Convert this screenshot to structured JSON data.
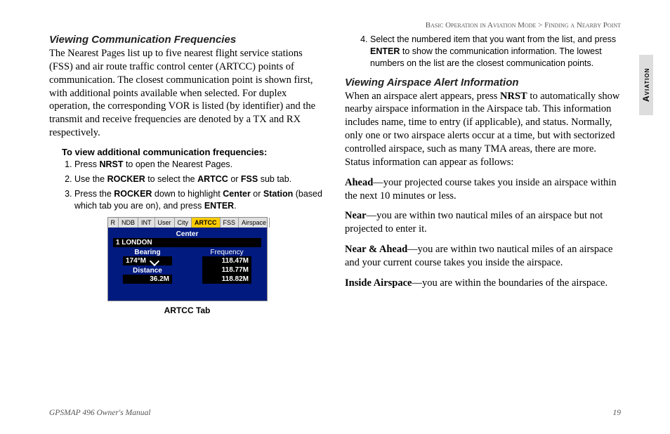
{
  "breadcrumb": {
    "a": "Basic Operation in Aviation Mode",
    "b": "Finding a Nearby Point",
    "sep": " > "
  },
  "sidetab": "Aviation",
  "left": {
    "heading": "Viewing Communication Frequencies",
    "para": "The Nearest Pages list up to five nearest flight service stations (FSS) and air route traffic control center (ARTCC) points of communication. The closest communication point is shown first, with additional points available when selected. For duplex operation, the corresponding VOR is listed (by identifier) and the transmit and receive frequencies are denoted by a TX and RX respectively.",
    "howto_title": "To view additional communication frequencies:",
    "steps": {
      "s1a": "Press ",
      "s1b": "NRST",
      "s1c": " to open the Nearest Pages.",
      "s2a": "Use the ",
      "s2b": "ROCKER",
      "s2c": " to select the ",
      "s2d": "ARTCC",
      "s2e": " or ",
      "s2f": "FSS",
      "s2g": " sub tab.",
      "s3a": "Press the ",
      "s3b": "ROCKER",
      "s3c": " down to highlight ",
      "s3d": "Center",
      "s3e": " or ",
      "s3f": "Station",
      "s3g": " (based which tab you are on), and press ",
      "s3h": "ENTER",
      "s3i": "."
    },
    "device": {
      "tabs": [
        "R",
        "NDB",
        "INT",
        "User",
        "City",
        "ARTCC",
        "FSS",
        "Airspace"
      ],
      "active_idx": 5,
      "center_label": "Center",
      "center_value": "1 LONDON",
      "bearing_label": "Bearing",
      "bearing_value": "174°M",
      "distance_label": "Distance",
      "distance_value": "36.2M",
      "freq_label": "Frequency",
      "freqs": [
        "118.47M",
        "118.77M",
        "118.82M"
      ]
    },
    "caption": "ARTCC Tab"
  },
  "right": {
    "step4": {
      "num": "4.",
      "a": "Select the numbered item that you want from the list, and press ",
      "b": "ENTER",
      "c": " to show the communication information. The lowest numbers on the list are the closest communication points."
    },
    "heading": "Viewing Airspace Alert Information",
    "para_a": "When an airspace alert appears, press ",
    "para_b": "NRST",
    "para_c": " to automatically show nearby airspace information in the Airspace tab. This information includes name, time to entry (if applicable), and status. Normally, only one or two airspace alerts occur at a time, but with sectorized controlled airspace, such as many TMA areas, there are more. Status information can appear as follows:",
    "defs": {
      "d1t": "Ahead",
      "d1b": "—your projected course takes you inside an airspace within the next 10 minutes or less.",
      "d2t": "Near",
      "d2b": "—you are within two nautical miles of an airspace but not projected to enter it.",
      "d3t": "Near & Ahead",
      "d3b": "—you are within two nautical miles of an airspace and your current course takes you inside the airspace.",
      "d4t": "Inside Airspace",
      "d4b": "—you are within the boundaries of the airspace."
    }
  },
  "footer": {
    "left": "GPSMAP 496 Owner's Manual",
    "right": "19"
  }
}
